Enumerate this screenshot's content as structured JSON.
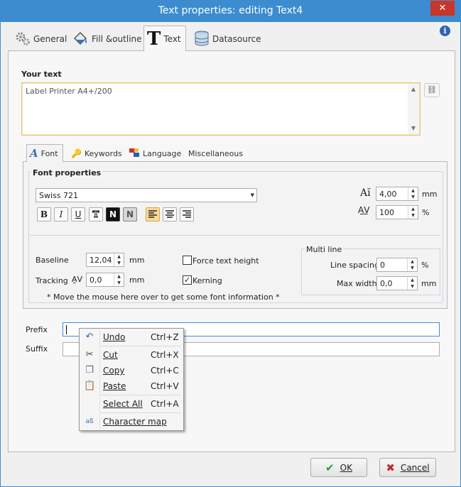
{
  "window": {
    "title": "Text properties: editing Text4"
  },
  "tabs": [
    {
      "label": "General",
      "icon": "gear-icon"
    },
    {
      "label": "Fill &outline",
      "icon": "paint-bucket-icon"
    },
    {
      "label": "Text",
      "icon": "text-t-icon"
    },
    {
      "label": "Datasource",
      "icon": "database-icon"
    }
  ],
  "your_text": {
    "heading": "Your text",
    "value": "Label Printer A4+/200"
  },
  "inner_tabs": [
    {
      "label": "Font",
      "icon": "font-a-icon"
    },
    {
      "label": "Keywords",
      "icon": "key-icon"
    },
    {
      "label": "Language",
      "icon": "language-flag-icon"
    },
    {
      "label": "Miscellaneous"
    }
  ],
  "font_props": {
    "heading": "Font properties",
    "font_name": "Swiss 721",
    "format_buttons": [
      "B",
      "I",
      "U",
      "T",
      "N",
      "N"
    ],
    "size_value": "4,00",
    "size_unit": "mm",
    "width_value": "100",
    "width_unit": "%",
    "baseline_label": "Baseline",
    "baseline_value": "12,04",
    "baseline_unit": "mm",
    "tracking_label": "Tracking",
    "tracking_value": "0,0",
    "tracking_unit": "mm",
    "force_height_label": "Force text height",
    "force_height_checked": false,
    "kerning_label": "Kerning",
    "kerning_checked": true,
    "hint": "* Move the mouse here over to get some font information *",
    "multiline_heading": "Multi line",
    "line_spacing_label": "Line spacing",
    "line_spacing_value": "0",
    "line_spacing_unit": "%",
    "max_width_label": "Max width",
    "max_width_value": "0,0",
    "max_width_unit": "mm"
  },
  "prefix_label": "Prefix",
  "suffix_label": "Suffix",
  "buttons": {
    "ok": "OK",
    "cancel": "Cancel"
  },
  "context_menu": {
    "undo": {
      "label": "Undo",
      "shortcut": "Ctrl+Z"
    },
    "cut": {
      "label": "Cut",
      "shortcut": "Ctrl+X"
    },
    "copy": {
      "label": "Copy",
      "shortcut": "Ctrl+C"
    },
    "paste": {
      "label": "Paste",
      "shortcut": "Ctrl+V"
    },
    "select_all": {
      "label": "Select All",
      "shortcut": "Ctrl+A"
    },
    "char_map": {
      "label": "Character map"
    }
  },
  "colors": {
    "titlebar": "#3c8ccf",
    "close": "#c7352b",
    "accent_active": "#fbd89a"
  }
}
